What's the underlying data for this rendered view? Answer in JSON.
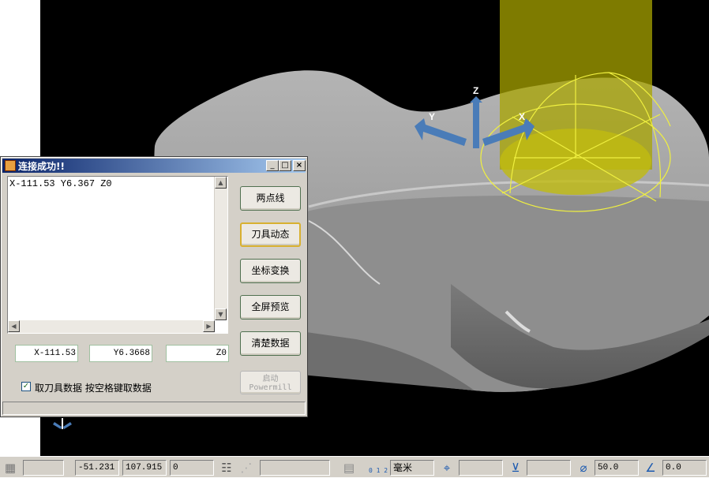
{
  "viewport": {
    "axes": {
      "z": "Z",
      "y": "Y",
      "x": "X"
    }
  },
  "dialog": {
    "title": "连接成功!!",
    "output_text": "X-111.53 Y6.367 Z0",
    "buttons": {
      "two_point_line": "两点线",
      "tool_dynamic": "刀具动态",
      "coord_transform": "坐标变换",
      "fullscreen_preview": "全屏预览",
      "clear_data": "清楚数据",
      "launch_powermill": "启动 Powermill"
    },
    "fields": {
      "x": "X-111.53",
      "y": "Y6.3668",
      "z": "Z0"
    },
    "checkbox": {
      "checked": true,
      "label": "取刀具数据  按空格键取数据"
    }
  },
  "toolbar": {
    "coord_x": "-51.231",
    "coord_y": "107.915",
    "coord_z": "0",
    "units": "毫米",
    "diameter": "50.0",
    "angle": "0.0",
    "ruler_digits": "0 1 2"
  }
}
